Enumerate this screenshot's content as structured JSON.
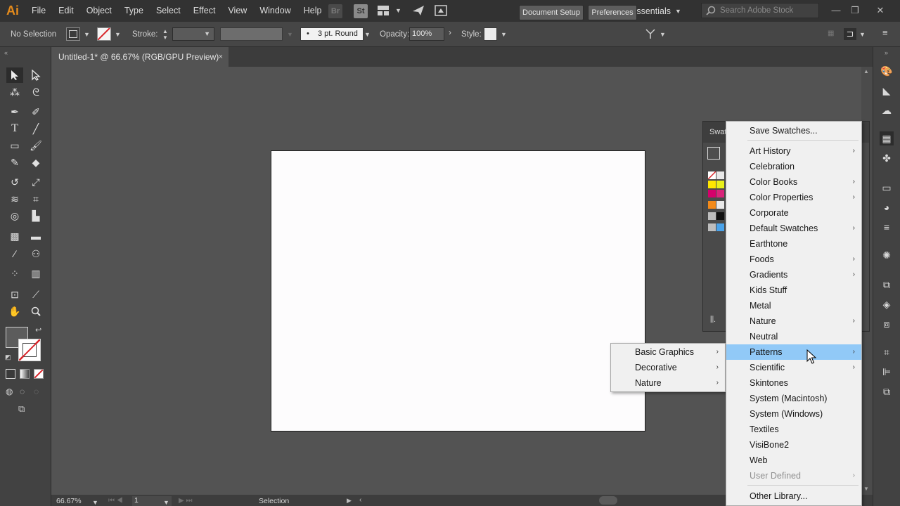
{
  "app": {
    "logo": "Ai"
  },
  "menubar": {
    "items": [
      "File",
      "Edit",
      "Object",
      "Type",
      "Select",
      "Effect",
      "View",
      "Window",
      "Help"
    ]
  },
  "topbar": {
    "bridge_label": "Br",
    "stock_label": "St",
    "workspace": "Essentials",
    "search_placeholder": "Search Adobe Stock"
  },
  "control": {
    "selection_label": "No Selection",
    "stroke_label": "Stroke:",
    "brush_label": "3 pt. Round",
    "opacity_label": "Opacity:",
    "opacity_value": "100%",
    "style_label": "Style:",
    "document_setup": "Document Setup",
    "preferences": "Preferences"
  },
  "document": {
    "tab_title": "Untitled-1* @ 66.67% (RGB/GPU Preview)",
    "close_label": "×"
  },
  "swatches_panel": {
    "title": "Swat"
  },
  "library_menu": {
    "items": [
      {
        "label": "Save Swatches...",
        "submenu": false
      },
      {
        "label": "Art History",
        "submenu": true
      },
      {
        "label": "Celebration",
        "submenu": false
      },
      {
        "label": "Color Books",
        "submenu": true
      },
      {
        "label": "Color Properties",
        "submenu": true
      },
      {
        "label": "Corporate",
        "submenu": false
      },
      {
        "label": "Default Swatches",
        "submenu": true
      },
      {
        "label": "Earthtone",
        "submenu": false
      },
      {
        "label": "Foods",
        "submenu": true
      },
      {
        "label": "Gradients",
        "submenu": true
      },
      {
        "label": "Kids Stuff",
        "submenu": false
      },
      {
        "label": "Metal",
        "submenu": false
      },
      {
        "label": "Nature",
        "submenu": true
      },
      {
        "label": "Neutral",
        "submenu": false
      },
      {
        "label": "Patterns",
        "submenu": true,
        "highlighted": true
      },
      {
        "label": "Scientific",
        "submenu": true
      },
      {
        "label": "Skintones",
        "submenu": false
      },
      {
        "label": "System (Macintosh)",
        "submenu": false
      },
      {
        "label": "System (Windows)",
        "submenu": false
      },
      {
        "label": "Textiles",
        "submenu": false
      },
      {
        "label": "VisiBone2",
        "submenu": false
      },
      {
        "label": "Web",
        "submenu": false
      },
      {
        "label": "User Defined",
        "submenu": true,
        "disabled": true
      },
      {
        "label": "Other Library...",
        "submenu": false
      }
    ]
  },
  "patterns_submenu": {
    "items": [
      "Basic Graphics",
      "Decorative",
      "Nature"
    ]
  },
  "statusbar": {
    "zoom": "66.67%",
    "artboard": "1",
    "tool": "Selection"
  },
  "colors": {
    "menu_highlight": "#91c9f7",
    "artboard": "#fdfcfd",
    "canvas": "#535353",
    "logo": "#e38a1c"
  }
}
